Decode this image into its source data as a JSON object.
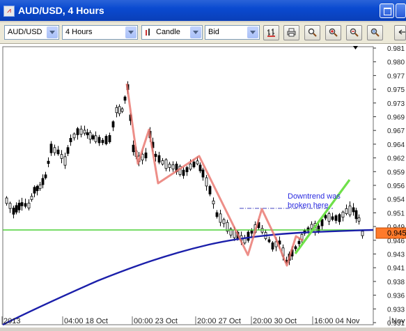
{
  "window": {
    "title": "AUD/USD,  4 Hours"
  },
  "toolbar": {
    "symbol": "AUD/USD",
    "period": "4 Hours",
    "chart_type": "Candle",
    "price_type": "Bid",
    "buttons": [
      {
        "name": "bar-chart-button",
        "icon": "bar-chart-icon"
      },
      {
        "name": "print-button",
        "icon": "printer-icon"
      },
      {
        "name": "zoom-button",
        "icon": "magnifier-icon"
      },
      {
        "name": "zoom-in-button",
        "icon": "zoom-in-icon"
      },
      {
        "name": "zoom-out-button",
        "icon": "zoom-out-icon"
      },
      {
        "name": "zoom-fit-button",
        "icon": "zoom-fit-icon"
      }
    ]
  },
  "chart_data": {
    "type": "candlestick",
    "y_ticks": [
      "0.981",
      "0.980",
      "0.977",
      "0.975",
      "0.973",
      "0.969",
      "0.967",
      "0.964",
      "0.962",
      "0.959",
      "0.956",
      "0.954",
      "0.951",
      "0.949",
      "0.946",
      "0.943",
      "0.941",
      "0.938",
      "0.936",
      "0.933",
      "0.931"
    ],
    "x_ticks": [
      "2013",
      "04:00 18 Oct",
      "00:00 23 Oct",
      "20:00 27 Oct",
      "20:00 30 Oct",
      "16:00 04 Nov",
      "Nov"
    ],
    "current_price": "0.945",
    "annotation": "Downtrend was\nbroken here",
    "colors": {
      "up": "#000000",
      "down": "#000000",
      "ma": "#1b1faa",
      "price_line": "#4cd137",
      "zigzag": "#e8726a",
      "breakout": "#6fe04a",
      "price_box": "#ff7a2a"
    }
  }
}
